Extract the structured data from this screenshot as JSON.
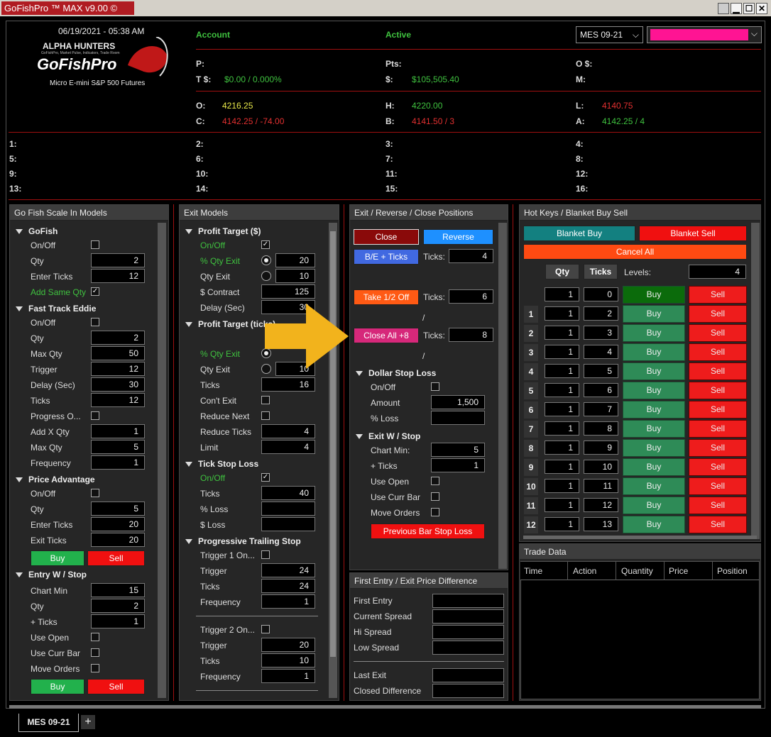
{
  "window": {
    "title": "GoFishPro ™ MAX v9.00 ©",
    "min": "▁",
    "max": "☐",
    "close": "✕"
  },
  "header": {
    "datetime": "06/19/2021 - 05:38 AM",
    "brand_top": "ALPHA HUNTERS",
    "brand_tag": "GoFishPro, Market Pulse, Indicators, Trade Room",
    "brand_main": "GoFishPro",
    "subtitle": "Micro E-mini S&P 500 Futures",
    "account_label": "Account",
    "active_label": "Active",
    "instrument": "MES 09-21",
    "p_label": "P:",
    "pts_label": "Pts:",
    "o_dollar_label": "O $:",
    "t_label": "T $:",
    "t_value": "$0.00 / 0.000%",
    "dollar_label": "$:",
    "dollar_value": "$105,505.40",
    "m_label": "M:",
    "o_label": "O:",
    "o_value": "4216.25",
    "h_label": "H:",
    "h_value": "4220.00",
    "l_label": "L:",
    "l_value": "4140.75",
    "c_label": "C:",
    "c_value": "4142.25 / -74.00",
    "b_label": "B:",
    "b_value": "4141.50 / 3",
    "a_label": "A:",
    "a_value": "4142.25 / 4",
    "slots": [
      "1:",
      "2:",
      "3:",
      "4:",
      "5:",
      "6:",
      "7:",
      "8:",
      "9:",
      "10:",
      "11:",
      "12:",
      "13:",
      "14:",
      "15:",
      "16:"
    ]
  },
  "scale_in": {
    "title": "Go Fish Scale In Models",
    "gofish": {
      "title": "GoFish",
      "onoff": "On/Off",
      "qty": "Qty",
      "qty_v": "2",
      "enter": "Enter Ticks",
      "enter_v": "12",
      "addsame": "Add Same Qty"
    },
    "fte": {
      "title": "Fast Track Eddie",
      "onoff": "On/Off",
      "qty": "Qty",
      "qty_v": "2",
      "maxqty": "Max Qty",
      "maxqty_v": "50",
      "trigger": "Trigger",
      "trigger_v": "12",
      "delay": "Delay (Sec)",
      "delay_v": "30",
      "ticks": "Ticks",
      "ticks_v": "12",
      "progress": "Progress O...",
      "addx": "Add X Qty",
      "addx_v": "1",
      "maxqty2": "Max Qty",
      "maxqty2_v": "5",
      "freq": "Frequency",
      "freq_v": "1"
    },
    "pa": {
      "title": "Price Advantage",
      "onoff": "On/Off",
      "qty": "Qty",
      "qty_v": "5",
      "enter": "Enter Ticks",
      "enter_v": "20",
      "exit": "Exit Ticks",
      "exit_v": "20",
      "buy": "Buy",
      "sell": "Sell"
    },
    "ews": {
      "title": "Entry W / Stop",
      "chartmin": "Chart Min",
      "chartmin_v": "15",
      "qty": "Qty",
      "qty_v": "2",
      "plus": "+ Ticks",
      "plus_v": "1",
      "useopen": "Use Open",
      "usecurr": "Use Curr Bar",
      "moveord": "Move Orders",
      "buy": "Buy",
      "sell": "Sell"
    }
  },
  "exit_models": {
    "title": "Exit Models",
    "pt": {
      "title": "Profit Target ($)",
      "onoff": "On/Off",
      "pqe": "% Qty Exit",
      "pqe_v": "20",
      "qe": "Qty Exit",
      "qe_v": "10",
      "contract": "$ Contract",
      "contract_v": "125",
      "delay": "Delay (Sec)",
      "delay_v": "30"
    },
    "ptt": {
      "title": "Profit Target (ticks)",
      "pqe": "% Qty Exit",
      "qe": "Qty Exit",
      "qe_v": "10",
      "ticks": "Ticks",
      "ticks_v": "16",
      "cont": "Con't Exit",
      "rnext": "Reduce Next",
      "rticks": "Reduce Ticks",
      "rticks_v": "4",
      "limit": "Limit",
      "limit_v": "4"
    },
    "tsl": {
      "title": "Tick Stop Loss",
      "onoff": "On/Off",
      "ticks": "Ticks",
      "ticks_v": "40",
      "ploss": "% Loss",
      "dloss": "$ Loss"
    },
    "pts": {
      "title": "Progressive Trailing Stop",
      "t1": "Trigger 1 On...",
      "trigger": "Trigger",
      "trigger_v": "24",
      "ticks": "Ticks",
      "ticks_v": "24",
      "freq": "Frequency",
      "freq_v": "1",
      "t2": "Trigger 2 On...",
      "trigger2_v": "20",
      "ticks2_v": "10",
      "freq2_v": "1"
    }
  },
  "erc": {
    "title": "Exit / Reverse / Close Positions",
    "close": "Close",
    "reverse": "Reverse",
    "be": "B/E + Ticks",
    "ticks": "Ticks:",
    "be_v": "4",
    "half": "Take 1/2 Off",
    "half_v": "6",
    "slash": "/",
    "closeall": "Close All +8",
    "closeall_v": "8",
    "dsl": {
      "title": "Dollar Stop Loss",
      "onoff": "On/Off",
      "amount": "Amount",
      "amount_v": "1,500",
      "ploss": "% Loss"
    },
    "exs": {
      "title": "Exit W / Stop",
      "chartmin": "Chart Min:",
      "chartmin_v": "5",
      "plus": "+ Ticks",
      "plus_v": "1",
      "useopen": "Use Open",
      "usecurr": "Use Curr Bar",
      "moveord": "Move Orders"
    },
    "pbsl": "Previous Bar Stop Loss"
  },
  "diff": {
    "title": "First Entry / Exit Price Difference",
    "first": "First Entry",
    "curr": "Current Spread",
    "hi": "Hi Spread",
    "low": "Low Spread",
    "last": "Last Exit",
    "closed": "Closed Difference"
  },
  "hotkeys": {
    "title": "Hot Keys / Blanket Buy Sell",
    "bbuy": "Blanket Buy",
    "bsell": "Blanket Sell",
    "cancel": "Cancel All",
    "qty": "Qty",
    "ticks": "Ticks",
    "levels": "Levels:",
    "levels_v": "4",
    "buy": "Buy",
    "sell": "Sell",
    "rows": [
      {
        "i": "",
        "q": "1",
        "t": "0"
      },
      {
        "i": "1",
        "q": "1",
        "t": "2"
      },
      {
        "i": "2",
        "q": "1",
        "t": "3"
      },
      {
        "i": "3",
        "q": "1",
        "t": "4"
      },
      {
        "i": "4",
        "q": "1",
        "t": "5"
      },
      {
        "i": "5",
        "q": "1",
        "t": "6"
      },
      {
        "i": "6",
        "q": "1",
        "t": "7"
      },
      {
        "i": "7",
        "q": "1",
        "t": "8"
      },
      {
        "i": "8",
        "q": "1",
        "t": "9"
      },
      {
        "i": "9",
        "q": "1",
        "t": "10"
      },
      {
        "i": "10",
        "q": "1",
        "t": "11"
      },
      {
        "i": "11",
        "q": "1",
        "t": "12"
      },
      {
        "i": "12",
        "q": "1",
        "t": "13"
      }
    ]
  },
  "trade": {
    "title": "Trade Data",
    "cols": [
      "Time",
      "Action",
      "Quantity",
      "Price",
      "Position"
    ]
  },
  "tabs": {
    "active": "MES 09-21",
    "add": "+"
  },
  "colors": {
    "accent_red": "#b01c22",
    "arrow": "#f2b31c",
    "pink": "#ff1493"
  }
}
